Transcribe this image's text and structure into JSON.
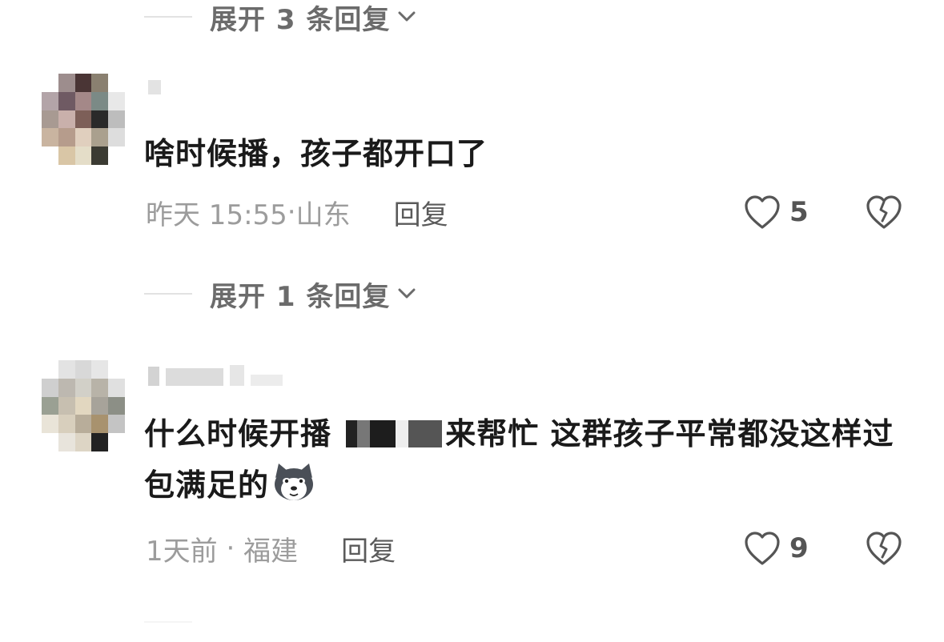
{
  "thread": {
    "expand_top": "展开 3 条回复",
    "comments": [
      {
        "text": "啥时候播，孩子都开口了",
        "time": "昨天 15:55",
        "location": "山东",
        "reply_label": "回复",
        "likes": "5",
        "expand_replies": "展开 1 条回复"
      },
      {
        "text_part1": "什么时候开播 ",
        "text_part2": "来帮忙 这群孩子平常都没这样过 包满足的",
        "time": "1天前",
        "location": "福建",
        "reply_label": "回复",
        "likes": "9"
      }
    ]
  },
  "icons": {
    "heart": "heart-outline-icon",
    "dislike": "broken-heart-icon",
    "chevron": "chevron-down-icon",
    "emoji": "husky-dog-emoji"
  },
  "colors": {
    "text": "#1a1a1a",
    "meta": "#9c9c9c",
    "expand": "#6b6b6b"
  }
}
